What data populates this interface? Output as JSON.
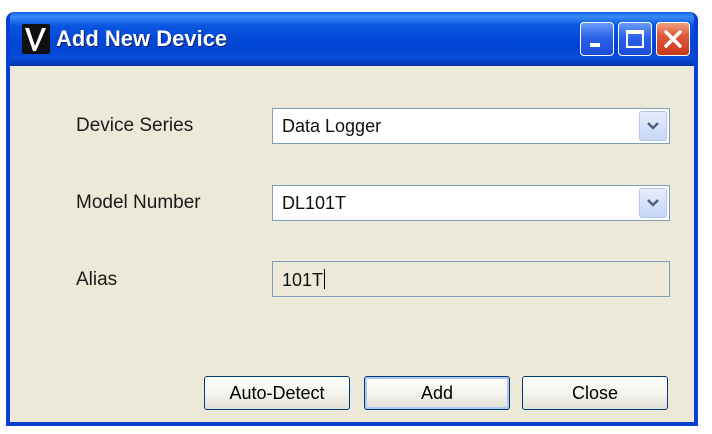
{
  "window": {
    "title": "Add New Device",
    "app_icon": "v-logo-icon",
    "controls": [
      "minimize-icon",
      "maximize-icon",
      "close-icon"
    ]
  },
  "form": {
    "device_series": {
      "label": "Device Series",
      "value": "Data Logger"
    },
    "model_number": {
      "label": "Model Number",
      "value": "DL101T"
    },
    "alias": {
      "label": "Alias",
      "value": "101T"
    }
  },
  "buttons": {
    "auto_detect": "Auto-Detect",
    "add": "Add",
    "close": "Close"
  },
  "colors": {
    "titlebar": "#0044d4",
    "window_bg": "#ece9d8",
    "close_button": "#e0583a"
  }
}
